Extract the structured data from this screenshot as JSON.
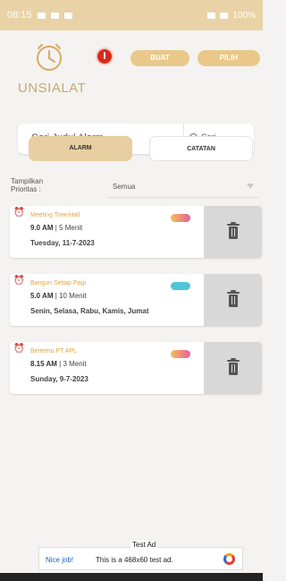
{
  "status_bar": {
    "time": "08:15",
    "battery": "100%"
  },
  "header": {
    "logo_text": "UNSIALAT",
    "buttons": [
      {
        "label": "BUAT"
      },
      {
        "label": "PILIH"
      }
    ]
  },
  "search": {
    "placeholder": "Cari Judul Alarm",
    "button_label": "Cari"
  },
  "tabs": [
    {
      "label": "ALARM",
      "active": true
    },
    {
      "label": "CATATAN",
      "active": false
    }
  ],
  "filter": {
    "label_line1": "Tampilkan",
    "label_line2": "Prioritas :",
    "value": "Semua"
  },
  "alarms": [
    {
      "title": "Meeting TownHall",
      "time": "9.0 AM",
      "duration": "5 Menit",
      "date": "Tuesday, 11-7-2023",
      "priority_color": [
        "#f2c05b",
        "#ec5d97"
      ]
    },
    {
      "title": "Bangun Setiap Pagi",
      "time": "5.0 AM",
      "duration": "10 Menit",
      "date": "Senin, Selasa, Rabu, Kamis, Jumat",
      "priority_color": [
        "#4ec6d6",
        "#4ec6d6"
      ]
    },
    {
      "title": "Bertemu PT APL",
      "time": "8.15 AM",
      "duration": "3 Menit",
      "date": "Sunday, 9-7-2023",
      "priority_color": [
        "#f2c05b",
        "#ec5d97"
      ]
    }
  ],
  "ad": {
    "title": "Test Ad",
    "nice_job": "Nice job!",
    "text": "This is a 468x60 test ad."
  },
  "colors": {
    "accent": "#e8cfa1",
    "status_bar": "#e9d2a6",
    "record": "#d62b1f"
  }
}
